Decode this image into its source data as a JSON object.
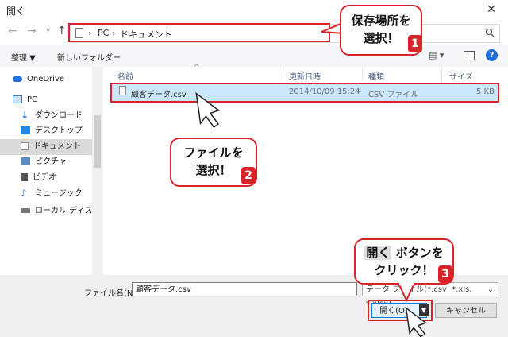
{
  "window": {
    "title": "開く",
    "close": "✕"
  },
  "nav": {
    "back": "←",
    "forward": "→",
    "dropdown": "▾",
    "up": "↑"
  },
  "address": {
    "crumbs": [
      "PC",
      "ドキュメント"
    ],
    "sep": "›"
  },
  "toolbar": {
    "organize": "整理 ▼",
    "new_folder": "新しいフォルダー",
    "view": "▤ ▾",
    "help": "?"
  },
  "sidebar": {
    "items": [
      {
        "label": "OneDrive",
        "color": "#1e6fd9"
      },
      {
        "label": "PC",
        "color": "#3a7bc8"
      },
      {
        "label": "ダウンロード",
        "color": "#2a7de1"
      },
      {
        "label": "デスクトップ",
        "color": "#1e88e5"
      },
      {
        "label": "ドキュメント",
        "color": "#8a8a8a"
      },
      {
        "label": "ピクチャ",
        "color": "#5b8bbf"
      },
      {
        "label": "ビデオ",
        "color": "#555"
      },
      {
        "label": "ミュージック",
        "color": "#2a7de1"
      },
      {
        "label": "ローカル ディスク (C",
        "color": "#555"
      }
    ]
  },
  "table": {
    "headers": {
      "name": "名前",
      "modified": "更新日時",
      "type": "種類",
      "size": "サイズ"
    },
    "rows": [
      {
        "name": "顧客データ.csv",
        "modified": "2014/10/09 15:24",
        "type": "CSV ファイル",
        "size": "5 KB"
      }
    ]
  },
  "bottom": {
    "filename_label": "ファイル名(N):",
    "filename_value": "顧客データ.csv",
    "filter_value": "テータ ファイル(*.csv, *.xls, *.xlsx)",
    "open_label": "開く(O)",
    "cancel_label": "キャンセル"
  },
  "callouts": {
    "c1": {
      "line1": "保存場所を",
      "line2": "選択！",
      "badge": "1"
    },
    "c2": {
      "line1": "ファイルを",
      "line2": "選択！",
      "badge": "2"
    },
    "c3": {
      "line1_key": "開く",
      "line1_rest": "ボタンを",
      "line2": "クリック！",
      "badge": "3"
    }
  },
  "accent": "#d9242b"
}
